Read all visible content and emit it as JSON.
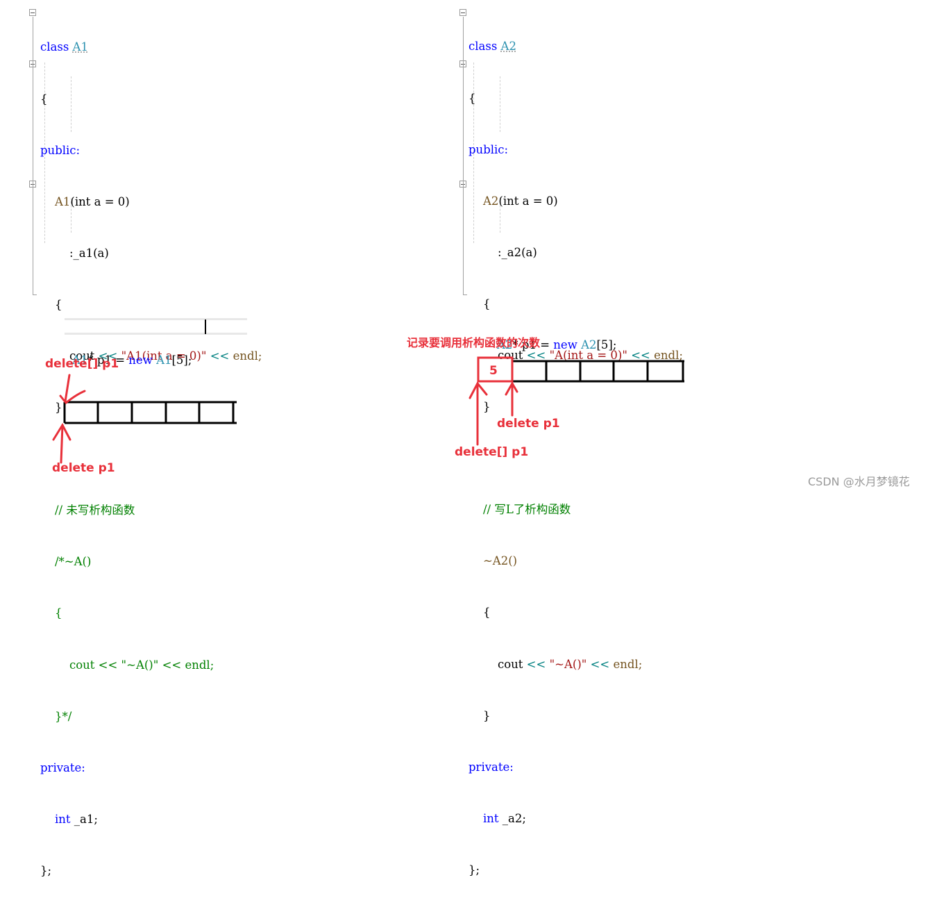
{
  "left_panel": {
    "class_keyword": "class",
    "class_name": "A1",
    "open_brace": "{",
    "public_label": "public:",
    "ctor_name": "A1",
    "ctor_params": "(int a = 0)",
    "init_list": ":_a1(a)",
    "ctor_open": "{",
    "cout_stmt": {
      "cout": "cout",
      "op1": "<<",
      "string": "\"A1(int a = 0)\"",
      "op2": "<<",
      "endl": "endl;"
    },
    "ctor_close": "}",
    "comment": "// 未写析构函数",
    "dtor_line": "/*~A()",
    "dtor_open": "{",
    "dtor_cout": "cout << \"~A()\" << endl;",
    "dtor_close": "}*/",
    "private_label": "private:",
    "member_decl": {
      "type": "int",
      "name": "_a1;"
    },
    "class_end": "};",
    "alloc_stmt": {
      "type": "A1",
      "rest1": "* p1 = ",
      "new_kw": "new",
      "cls": "A1",
      "rest2": "[5];"
    },
    "labels": {
      "delete_array": "delete[] p1",
      "delete_single": "delete p1"
    },
    "array_cells": 5
  },
  "right_panel": {
    "class_keyword": "class",
    "class_name": "A2",
    "open_brace": "{",
    "public_label": "public:",
    "ctor_name": "A2",
    "ctor_params": "(int a = 0)",
    "init_list": ":_a2(a)",
    "ctor_open": "{",
    "cout_stmt": {
      "cout": "cout",
      "op1": "<<",
      "string": "\"A(int a = 0)\"",
      "op2": "<<",
      "endl": "endl;"
    },
    "ctor_close": "}",
    "comment": "// 写L了析构函数",
    "dtor_line": "~A2()",
    "dtor_open": "{",
    "dtor_cout": {
      "cout": "cout",
      "op1": "<<",
      "string": "\"~A()\"",
      "op2": "<<",
      "endl": "endl;"
    },
    "dtor_close": "}",
    "private_label": "private:",
    "member_decl": {
      "type": "int",
      "name": "_a2;"
    },
    "class_end": "};",
    "alloc_stmt": {
      "type": "A2",
      "rest1": "* p1 = ",
      "new_kw": "new",
      "cls": "A2",
      "rest2": "[5];"
    },
    "labels": {
      "count_note": "记录要调用析构函数的次数",
      "count_value": "5",
      "delete_single": "delete p1",
      "delete_array": "delete[] p1"
    },
    "array_cells": 5
  },
  "watermark": "CSDN @水月梦镜花",
  "colors": {
    "annotation_red": "#e8303a",
    "keyword_blue": "#0000ff",
    "class_teal": "#2b91af",
    "string_red": "#a31515",
    "comment_green": "#008000"
  }
}
